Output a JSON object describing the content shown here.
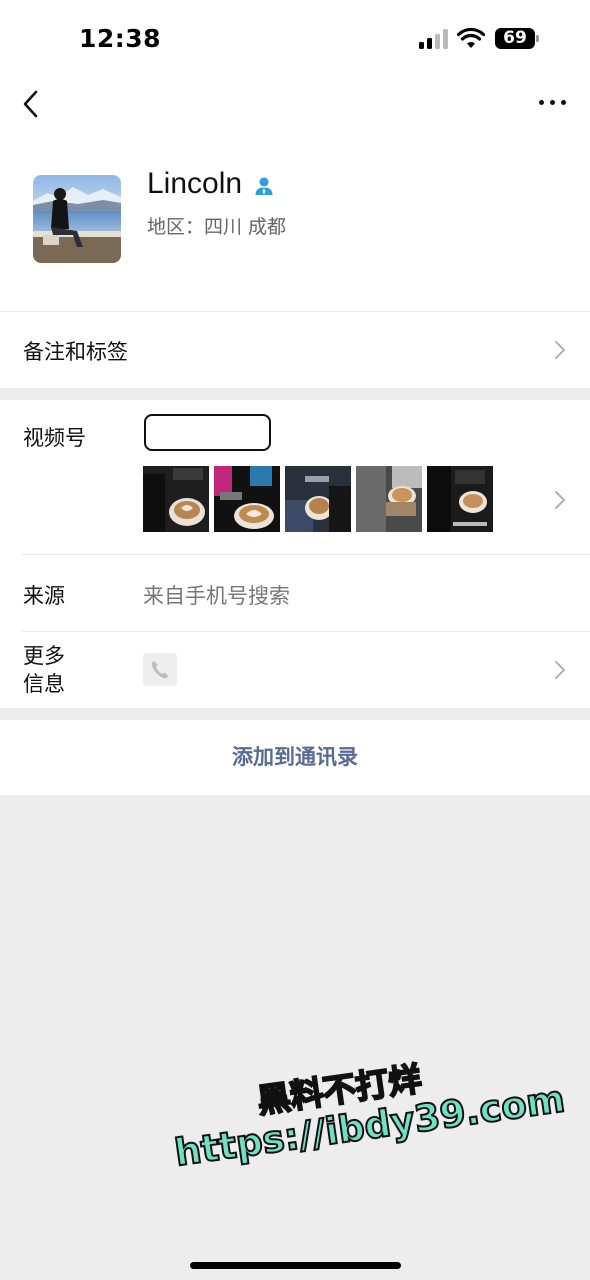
{
  "status_bar": {
    "time": "12:38",
    "battery": "69"
  },
  "profile": {
    "name": "Lincoln",
    "region": "地区：四川 成都",
    "avatar": "avatar-photo-lake"
  },
  "rows": {
    "remark_label": "备注和标签",
    "channels_label": "视频号",
    "source_label": "来源",
    "source_value": "来自手机号搜索",
    "more_info_label_1": "更多",
    "more_info_label_2": "信息"
  },
  "actions": {
    "add_contact": "添加到通讯录"
  },
  "watermark": {
    "line1": "黑料不打烊",
    "line2": "https://ibdy39.com"
  },
  "colors": {
    "link": "#576b95",
    "verified": "#2c9ed9",
    "background": "#ededed",
    "watermark": "#6fe0c3"
  },
  "icons": [
    "back-arrow-icon",
    "more-dots-icon",
    "verified-user-icon",
    "chevron-right-icon",
    "phone-icon"
  ]
}
